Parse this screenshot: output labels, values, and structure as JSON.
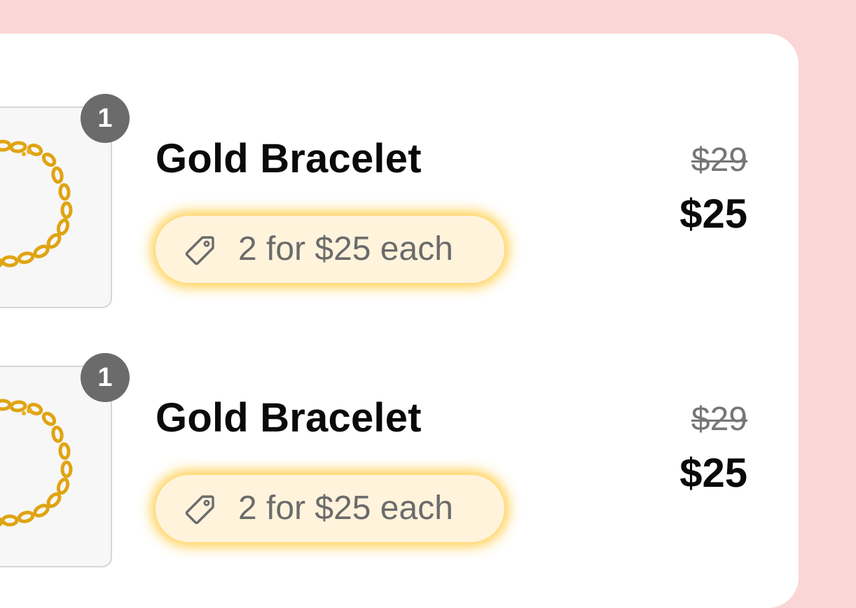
{
  "cart": {
    "items": [
      {
        "quantity": "1",
        "title": "Gold Bracelet",
        "promo": "2 for $25 each",
        "original_price": "$29",
        "sale_price": "$25",
        "promo_icon": "tag-icon",
        "image": "gold-chain-bracelet"
      },
      {
        "quantity": "1",
        "title": "Gold Bracelet",
        "promo": "2 for $25 each",
        "original_price": "$29",
        "sale_price": "$25",
        "promo_icon": "tag-icon",
        "image": "gold-chain-bracelet"
      }
    ]
  },
  "colors": {
    "background": "#fbd6d6",
    "card": "#ffffff",
    "promo_fill": "#fff3dc",
    "promo_glow": "#ffc428",
    "badge": "#6b6b6b",
    "muted_text": "#6b6b6b",
    "gold": "#e0a412"
  }
}
